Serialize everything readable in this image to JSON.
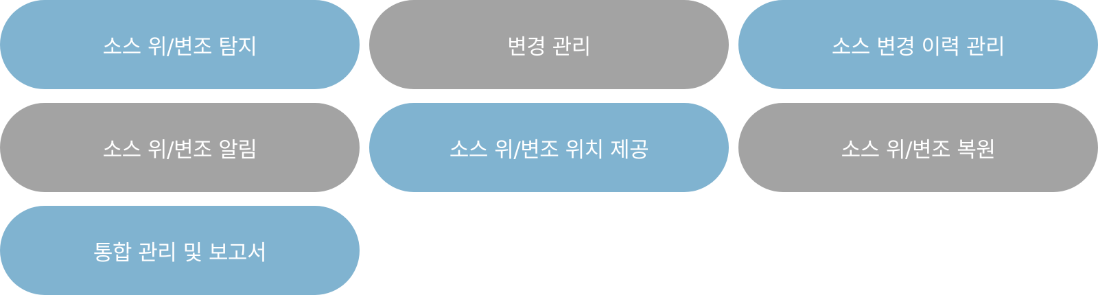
{
  "items": [
    {
      "label": "소스 위/변조 탐지",
      "color": "#80b3d0"
    },
    {
      "label": "변경 관리",
      "color": "#a3a3a3"
    },
    {
      "label": "소스 변경 이력 관리",
      "color": "#80b3d0"
    },
    {
      "label": "소스 위/변조 알림",
      "color": "#a3a3a3"
    },
    {
      "label": "소스 위/변조 위치 제공",
      "color": "#80b3d0"
    },
    {
      "label": "소스 위/변조 복원",
      "color": "#a3a3a3"
    },
    {
      "label": "통합 관리 및 보고서",
      "color": "#80b3d0"
    }
  ]
}
